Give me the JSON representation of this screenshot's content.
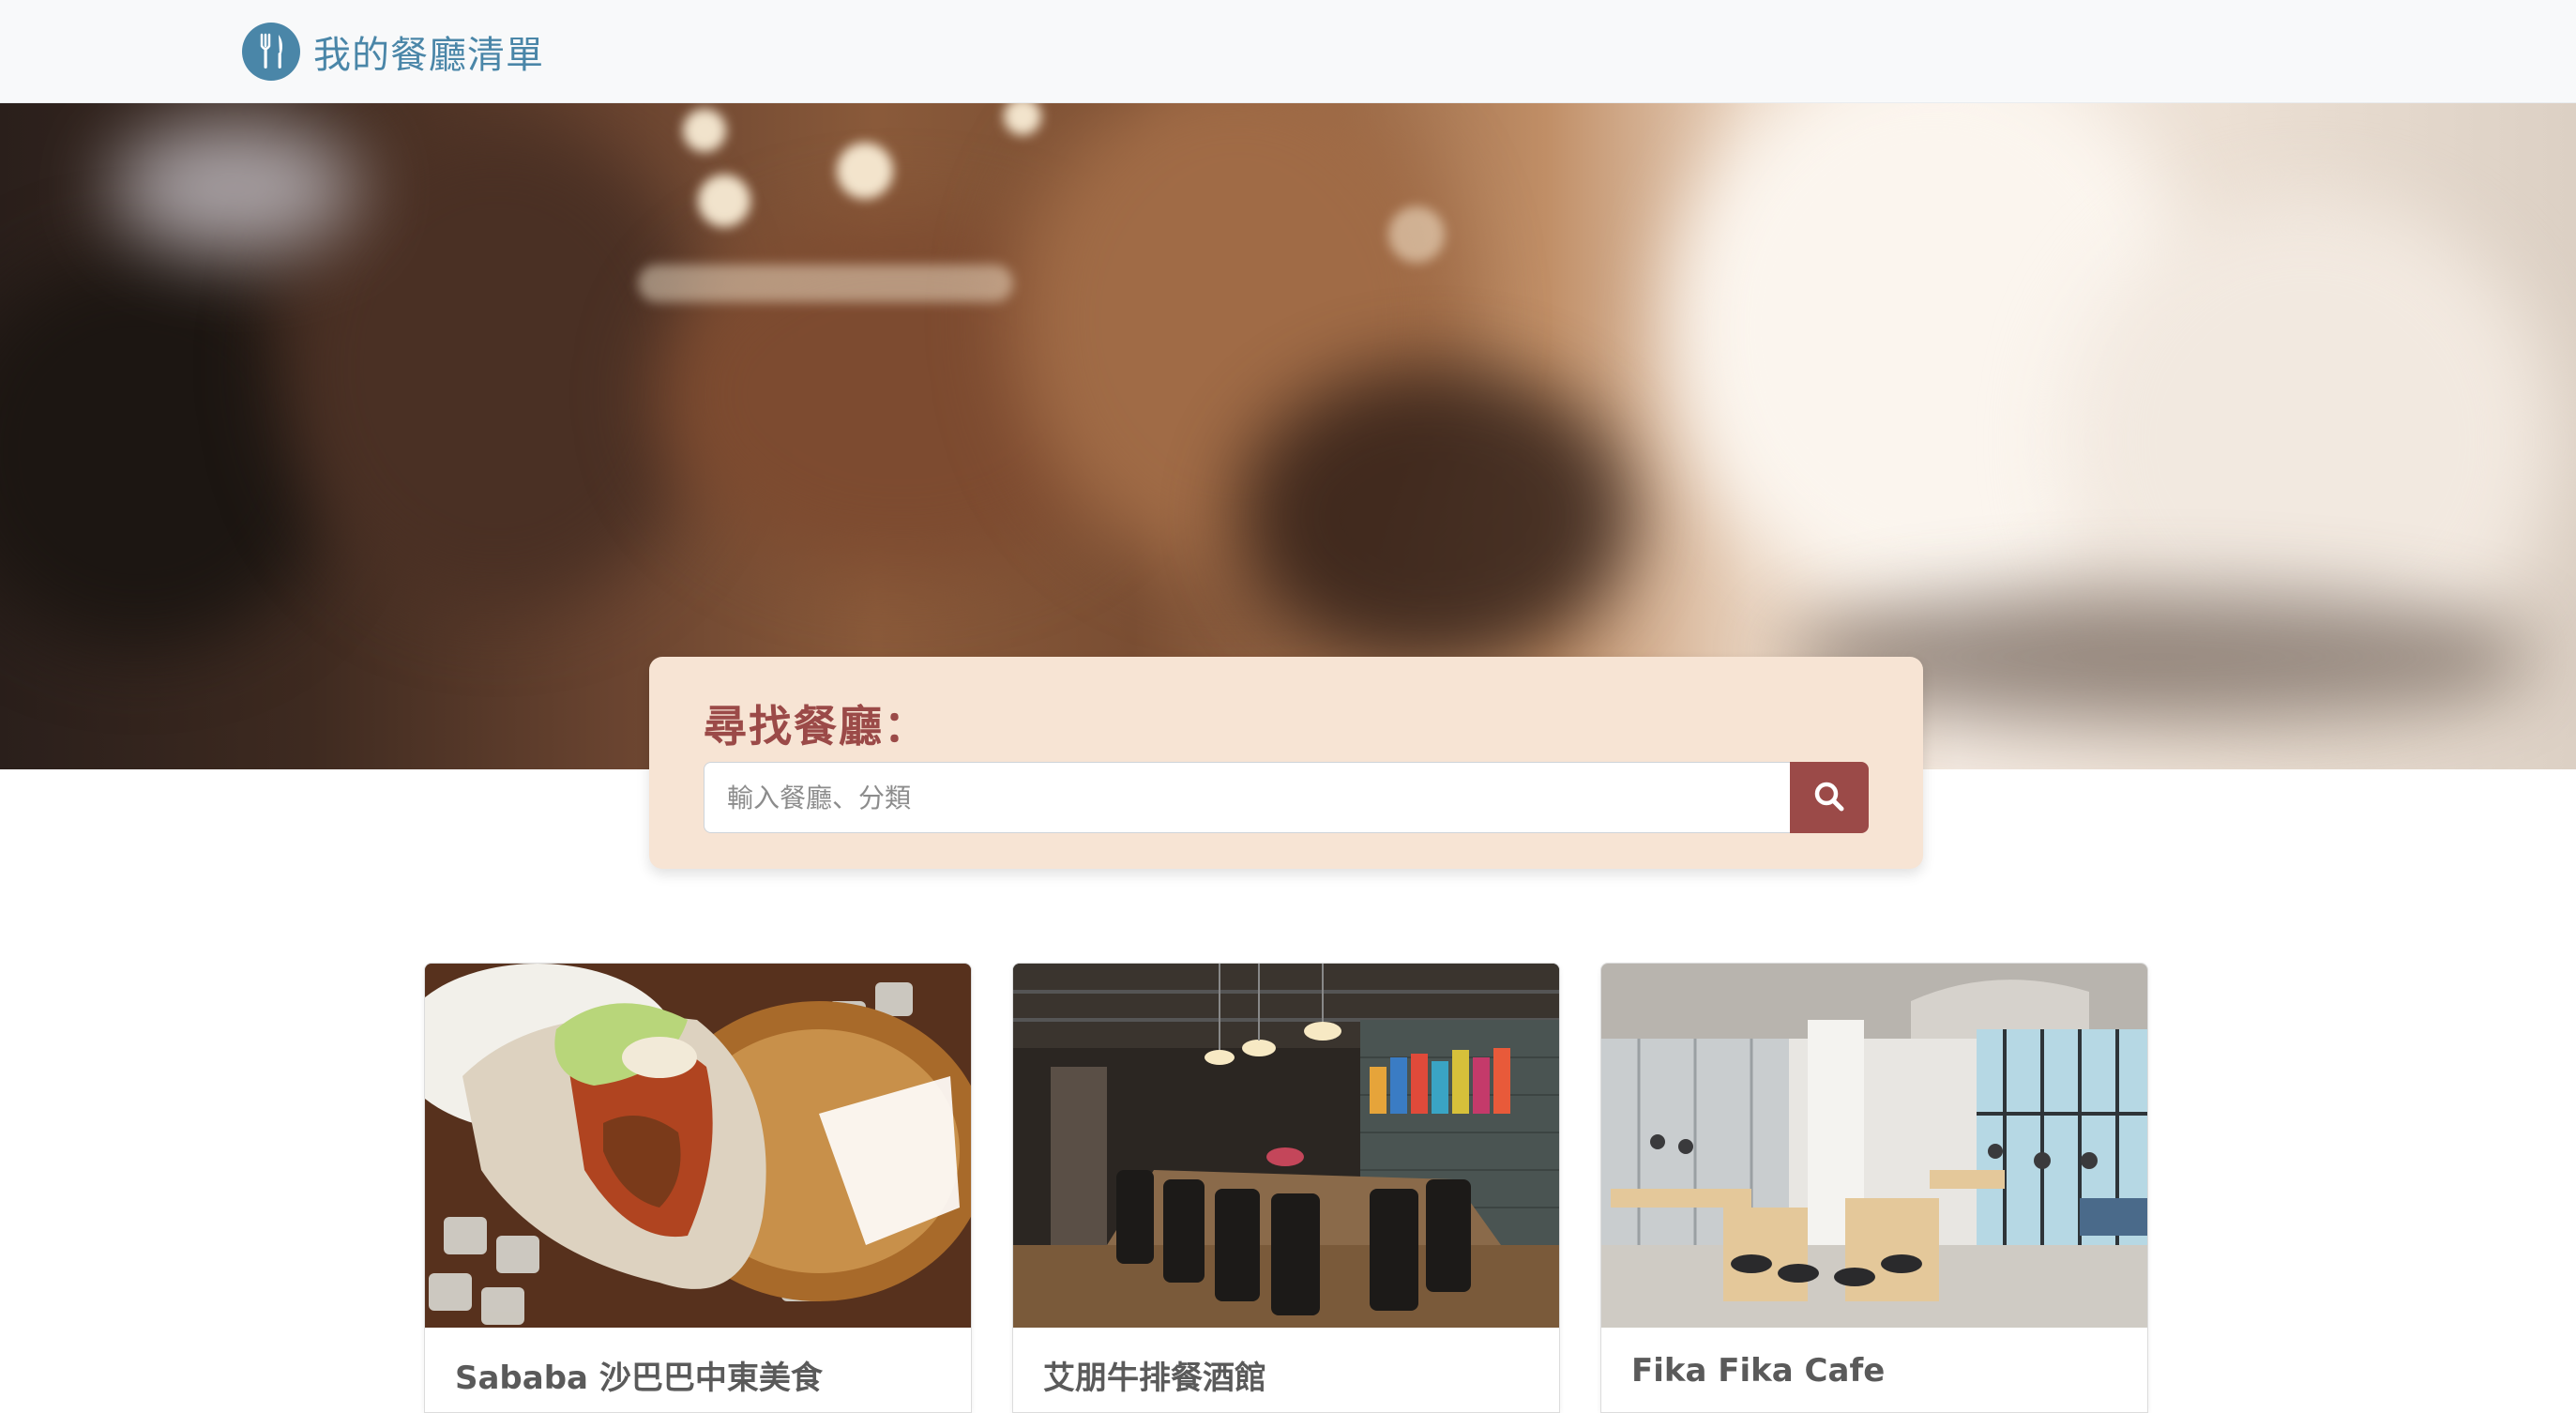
{
  "navbar": {
    "brand_text": "我的餐廳清單",
    "brand_icon": "utensils-icon"
  },
  "search": {
    "title": "尋找餐廳：",
    "placeholder": "輸入餐廳、分類",
    "value": "",
    "button_icon": "search-icon"
  },
  "restaurants": [
    {
      "name": "Sababa 沙巴巴中東美食"
    },
    {
      "name": "艾朋牛排餐酒館"
    },
    {
      "name": "Fika Fika Cafe"
    }
  ],
  "colors": {
    "brand": "#4a86a8",
    "accent": "#9b4a48",
    "search_panel_bg": "#f7e4d4",
    "navbar_bg": "#f8f9fa"
  }
}
